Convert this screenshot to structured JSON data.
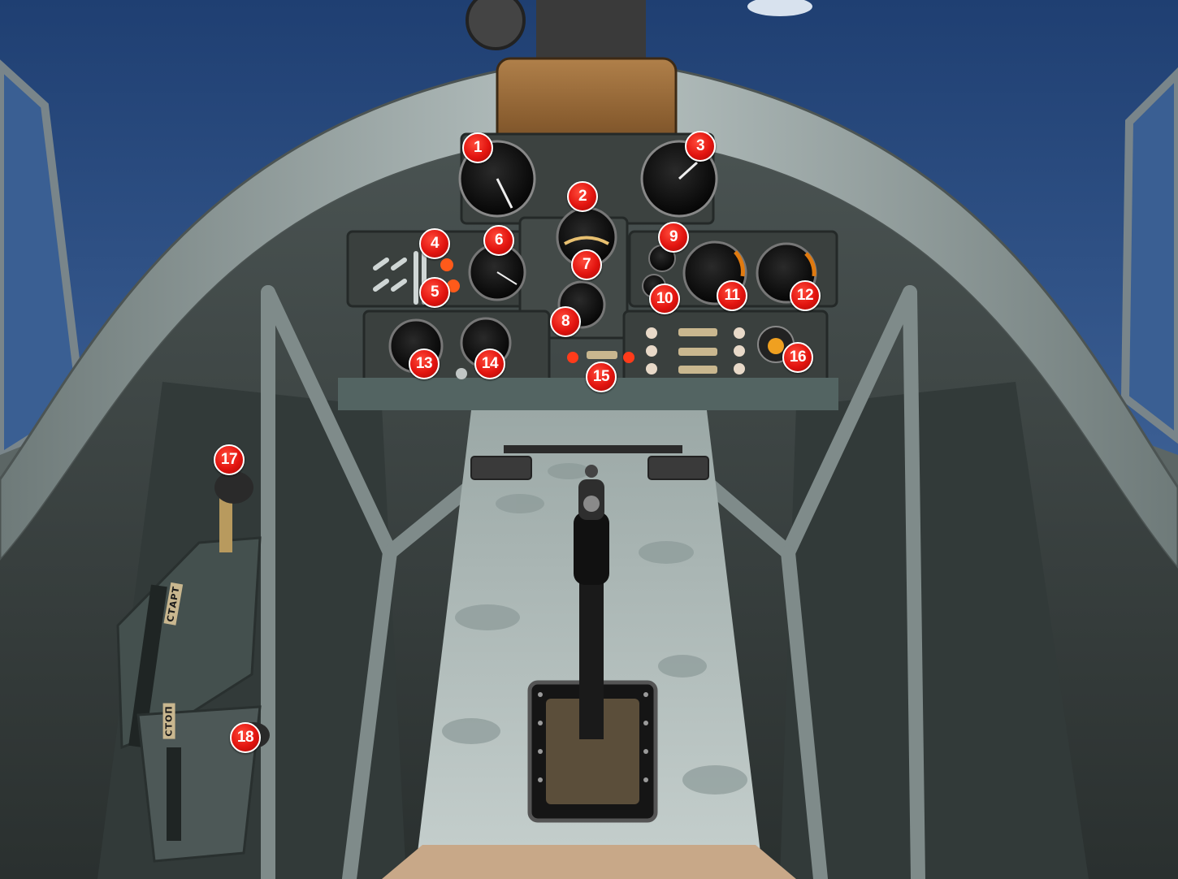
{
  "callouts": [
    "1",
    "2",
    "3",
    "4",
    "5",
    "6",
    "7",
    "8",
    "9",
    "10",
    "11",
    "12",
    "13",
    "14",
    "15",
    "16",
    "17",
    "18"
  ],
  "placards": {
    "start": "СТАРТ",
    "stop": "СТОП"
  },
  "colors": {
    "sky": "#2b4a7a",
    "canopy_frame": "#8f9b9a",
    "panel": "#3e4442",
    "badge": "#e2140f",
    "floor": "#b8c4c2"
  }
}
